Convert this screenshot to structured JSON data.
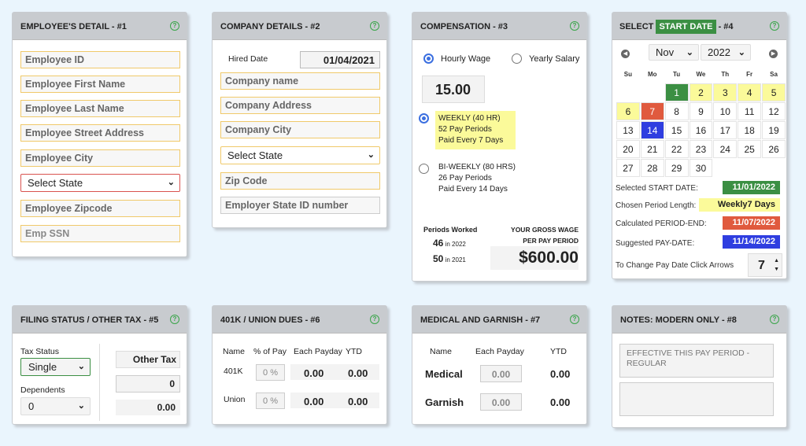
{
  "employee": {
    "title": "EMPLOYEE'S DETAIL - #1",
    "fields": [
      "Employee ID",
      "Employee First Name",
      "Employee Last Name",
      "Employee Street Address",
      "Employee City"
    ],
    "state": "Select State",
    "fields2": [
      "Employee Zipcode",
      "Emp SSN"
    ]
  },
  "company": {
    "title": "COMPANY DETAILS - #2",
    "hired_label": "Hired Date",
    "hired_value": "01/04/2021",
    "fields": [
      "Company name",
      "Company Address",
      "Company City"
    ],
    "state": "Select State",
    "fields2": [
      "Zip Code",
      "Employer State ID number"
    ]
  },
  "comp": {
    "title": "COMPENSATION - #3",
    "hourly": "Hourly Wage",
    "yearly": "Yearly Salary",
    "wage": "15.00",
    "weekly": [
      "WEEKLY (40 HR)",
      "52 Pay Periods",
      "Paid Every 7 Days"
    ],
    "biweekly": [
      "BI-WEEKLY (80 HRS)",
      "26 Pay Periods",
      "Paid Every 14 Days"
    ],
    "periods_label": "Periods Worked",
    "p1n": "46",
    "p1y": "in 2022",
    "p2n": "50",
    "p2y": "in 2021",
    "gross1": "YOUR GROSS WAGE",
    "gross2": "PER PAY PERIOD",
    "gross": "$600.00"
  },
  "cal": {
    "title1": "SELECT",
    "title_hl": "START DATE",
    "title2": "- #4",
    "month": "Nov",
    "year": "2022",
    "days": [
      "Su",
      "Mo",
      "Tu",
      "We",
      "Th",
      "Fr",
      "Sa"
    ],
    "weeks": [
      [
        "",
        "",
        "1",
        "2",
        "3",
        "4",
        "5"
      ],
      [
        "6",
        "7",
        "8",
        "9",
        "10",
        "11",
        "12"
      ],
      [
        "13",
        "14",
        "15",
        "16",
        "17",
        "18",
        "19"
      ],
      [
        "20",
        "21",
        "22",
        "23",
        "24",
        "25",
        "26"
      ],
      [
        "27",
        "28",
        "29",
        "30",
        "",
        "",
        ""
      ]
    ],
    "start_label": "Selected START DATE:",
    "start": "11/01/2022",
    "len_label": "Chosen Period Length:",
    "len": "Weekly7 Days",
    "end_label": "Calculated PERIOD-END:",
    "end": "11/07/2022",
    "pay_label": "Suggested PAY-DATE:",
    "pay": "11/14/2022",
    "arrows_label": "To Change Pay Date Click Arrows",
    "arrows_value": "7",
    "colors": {
      "start": "#3b8f43",
      "period": "#fbfa9a",
      "end": "#e05a3e",
      "pay": "#2f3ee0"
    }
  },
  "filing": {
    "title": "FILING STATUS / OTHER TAX - #5",
    "tax_label": "Tax Status",
    "tax": "Single",
    "dep_label": "Dependents",
    "dep": "0",
    "other": "Other Tax",
    "other_val": "0",
    "other_total": "0.00"
  },
  "k401": {
    "title": "401K / UNION DUES - #6",
    "cols": [
      "Name",
      "% of Pay",
      "Each Payday",
      "YTD"
    ],
    "rows": [
      {
        "name": "401K",
        "pct": "0 %",
        "each": "0.00",
        "ytd": "0.00"
      },
      {
        "name": "Union",
        "pct": "0 %",
        "each": "0.00",
        "ytd": "0.00"
      }
    ]
  },
  "medical": {
    "title": "MEDICAL AND GARNISH - #7",
    "cols": [
      "Name",
      "Each Payday",
      "YTD"
    ],
    "rows": [
      {
        "name": "Medical",
        "each": "0.00",
        "ytd": "0.00"
      },
      {
        "name": "Garnish",
        "each": "0.00",
        "ytd": "0.00"
      }
    ]
  },
  "notes": {
    "title": "NOTES: MODERN ONLY - #8",
    "note1": "EFFECTIVE THIS PAY PERIOD - REGULAR",
    "note2": ""
  }
}
